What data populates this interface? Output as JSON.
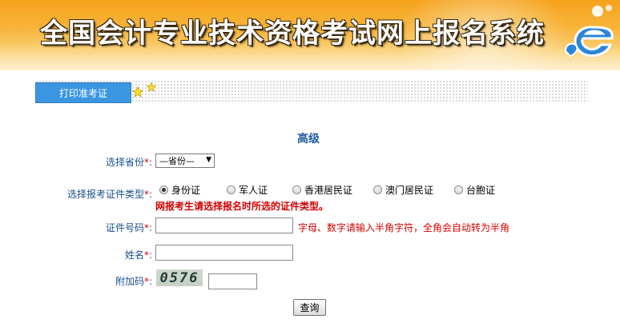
{
  "banner": {
    "title": "全国会计专业技术资格考试网上报名系统"
  },
  "tabs": {
    "print_label": "打印准考证"
  },
  "form": {
    "title": "高级",
    "province_label": "选择省份",
    "province_value": "—省份—",
    "id_type_label": "选择报考证件类型",
    "id_types": [
      "身份证",
      "军人证",
      "香港居民证",
      "澳门居民证",
      "台胞证"
    ],
    "id_type_selected": "身份证",
    "warning": "网报考生请选择报名时所选的证件类型。",
    "id_number_label": "证件号码",
    "id_number_hint": "字母、数字请输入半角字符，全角会自动转为半角",
    "name_label": "姓名",
    "captcha_label": "附加码",
    "captcha_code": "0576",
    "required_mark": "*",
    "colon": ":",
    "submit_label": "查询"
  },
  "colors": {
    "banner_orange": "#f6a21a",
    "tab_blue": "#3b96e1",
    "label_blue": "#1a4f8a",
    "warning_red": "#d40000"
  }
}
